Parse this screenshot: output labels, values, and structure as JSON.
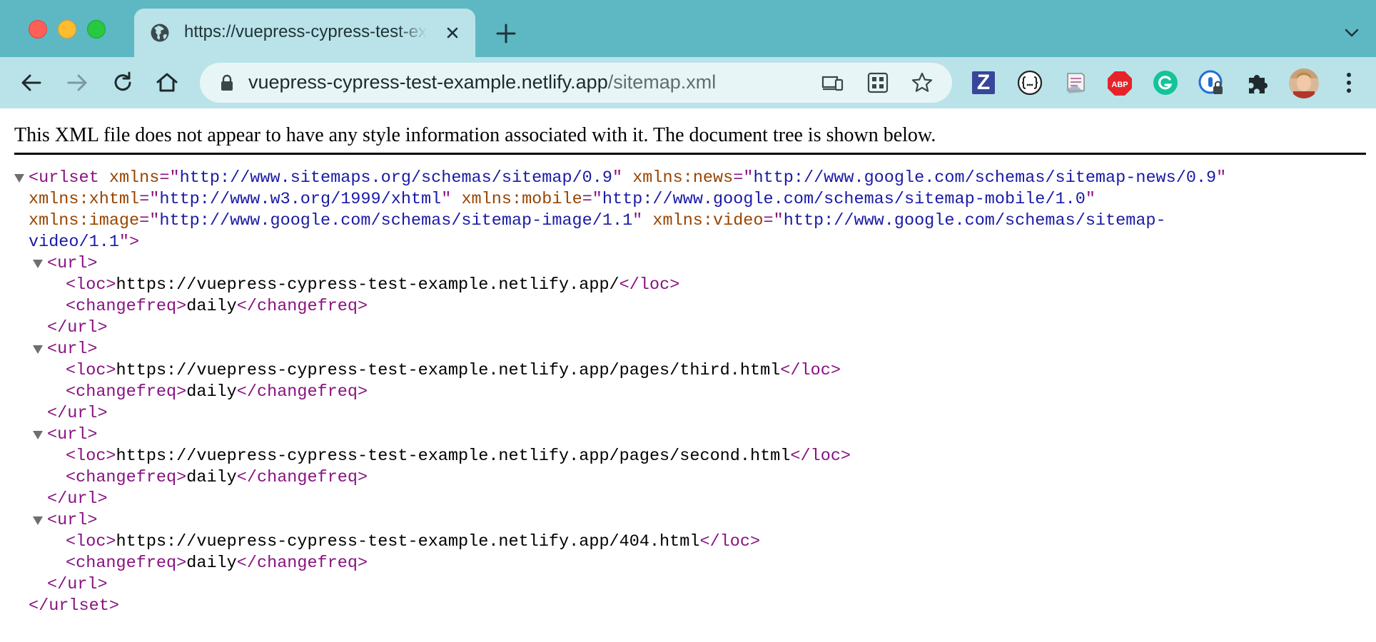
{
  "tab": {
    "title": "https://vuepress-cypress-test-example.netlify.app/sitemap.xml"
  },
  "address": {
    "host": "vuepress-cypress-test-example.netlify.app",
    "path": "/sitemap.xml"
  },
  "extensions": {
    "zotero_label": "Z",
    "abp_label": "ABP"
  },
  "notice": "This XML file does not appear to have any style information associated with it. The document tree is shown below.",
  "xml": {
    "root_tag": "urlset",
    "attrs": [
      {
        "name": "xmlns",
        "value": "http://www.sitemaps.org/schemas/sitemap/0.9"
      },
      {
        "name": "xmlns:news",
        "value": "http://www.google.com/schemas/sitemap-news/0.9"
      },
      {
        "name": "xmlns:xhtml",
        "value": "http://www.w3.org/1999/xhtml"
      },
      {
        "name": "xmlns:mobile",
        "value": "http://www.google.com/schemas/sitemap-mobile/1.0"
      },
      {
        "name": "xmlns:image",
        "value": "http://www.google.com/schemas/sitemap-image/1.1"
      },
      {
        "name": "xmlns:video",
        "value_part1": "http://www.google.com/schemas/sitemap-",
        "value_part2": "video/1.1"
      }
    ],
    "url_tag": "url",
    "loc_tag": "loc",
    "changefreq_tag": "changefreq",
    "urls": [
      {
        "loc": "https://vuepress-cypress-test-example.netlify.app/",
        "changefreq": "daily"
      },
      {
        "loc": "https://vuepress-cypress-test-example.netlify.app/pages/third.html",
        "changefreq": "daily"
      },
      {
        "loc": "https://vuepress-cypress-test-example.netlify.app/pages/second.html",
        "changefreq": "daily"
      },
      {
        "loc": "https://vuepress-cypress-test-example.netlify.app/404.html",
        "changefreq": "daily"
      }
    ]
  },
  "colors": {
    "tab_strip": "#5db8c4",
    "toolbar": "#b9e3e8",
    "xml_tag": "#881280",
    "xml_attr": "#994500",
    "xml_value": "#1a1aa6"
  }
}
